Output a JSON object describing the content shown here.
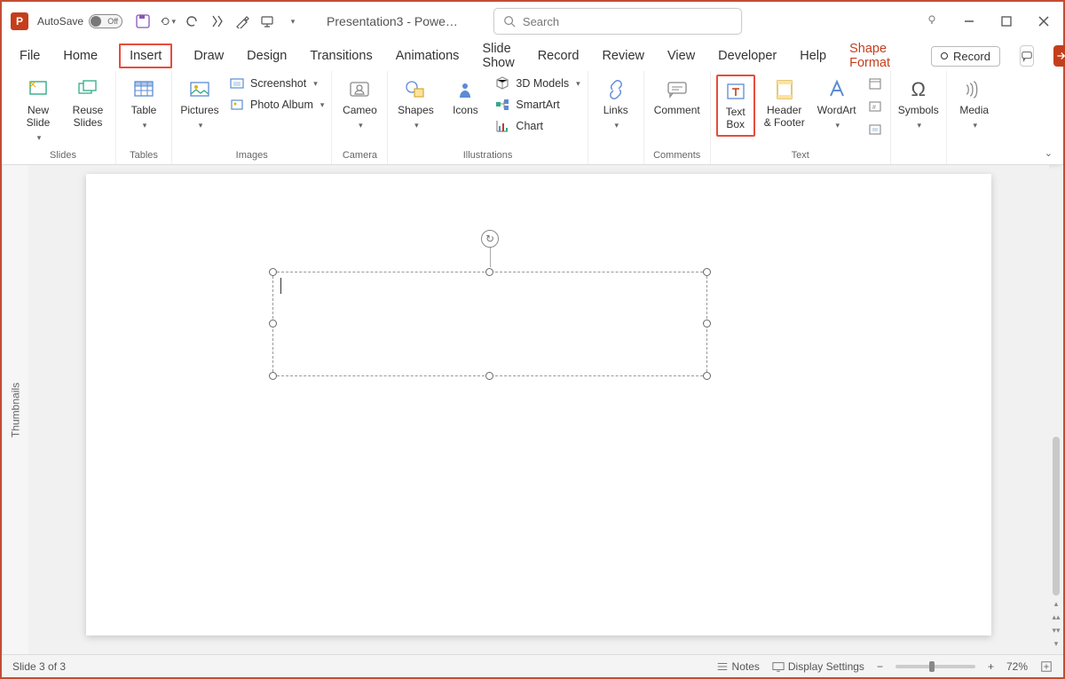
{
  "titlebar": {
    "autosave_label": "AutoSave",
    "autosave_state": "Off",
    "doc_title": "Presentation3 - Powe…",
    "search_placeholder": "Search"
  },
  "tabs": {
    "file": "File",
    "home": "Home",
    "insert": "Insert",
    "draw": "Draw",
    "design": "Design",
    "transitions": "Transitions",
    "animations": "Animations",
    "slideshow": "Slide Show",
    "record": "Record",
    "review": "Review",
    "view": "View",
    "developer": "Developer",
    "help": "Help",
    "shape_format": "Shape Format",
    "record_button": "Record"
  },
  "ribbon": {
    "slides": {
      "new_slide": "New\nSlide",
      "reuse_slides": "Reuse\nSlides",
      "group": "Slides"
    },
    "tables": {
      "table": "Table",
      "group": "Tables"
    },
    "images": {
      "pictures": "Pictures",
      "screenshot": "Screenshot",
      "photo_album": "Photo Album",
      "group": "Images"
    },
    "camera": {
      "cameo": "Cameo",
      "group": "Camera"
    },
    "illustrations": {
      "shapes": "Shapes",
      "icons": "Icons",
      "models": "3D Models",
      "smartart": "SmartArt",
      "chart": "Chart",
      "group": "Illustrations"
    },
    "links": {
      "links": "Links"
    },
    "comments": {
      "comment": "Comment",
      "group": "Comments"
    },
    "text": {
      "text_box": "Text\nBox",
      "header_footer": "Header\n& Footer",
      "wordart": "WordArt",
      "group": "Text"
    },
    "symbols": {
      "symbols": "Symbols"
    },
    "media": {
      "media": "Media"
    }
  },
  "side": {
    "thumbnails": "Thumbnails"
  },
  "statusbar": {
    "slide": "Slide 3 of 3",
    "notes": "Notes",
    "display": "Display Settings",
    "zoom": "72%"
  }
}
